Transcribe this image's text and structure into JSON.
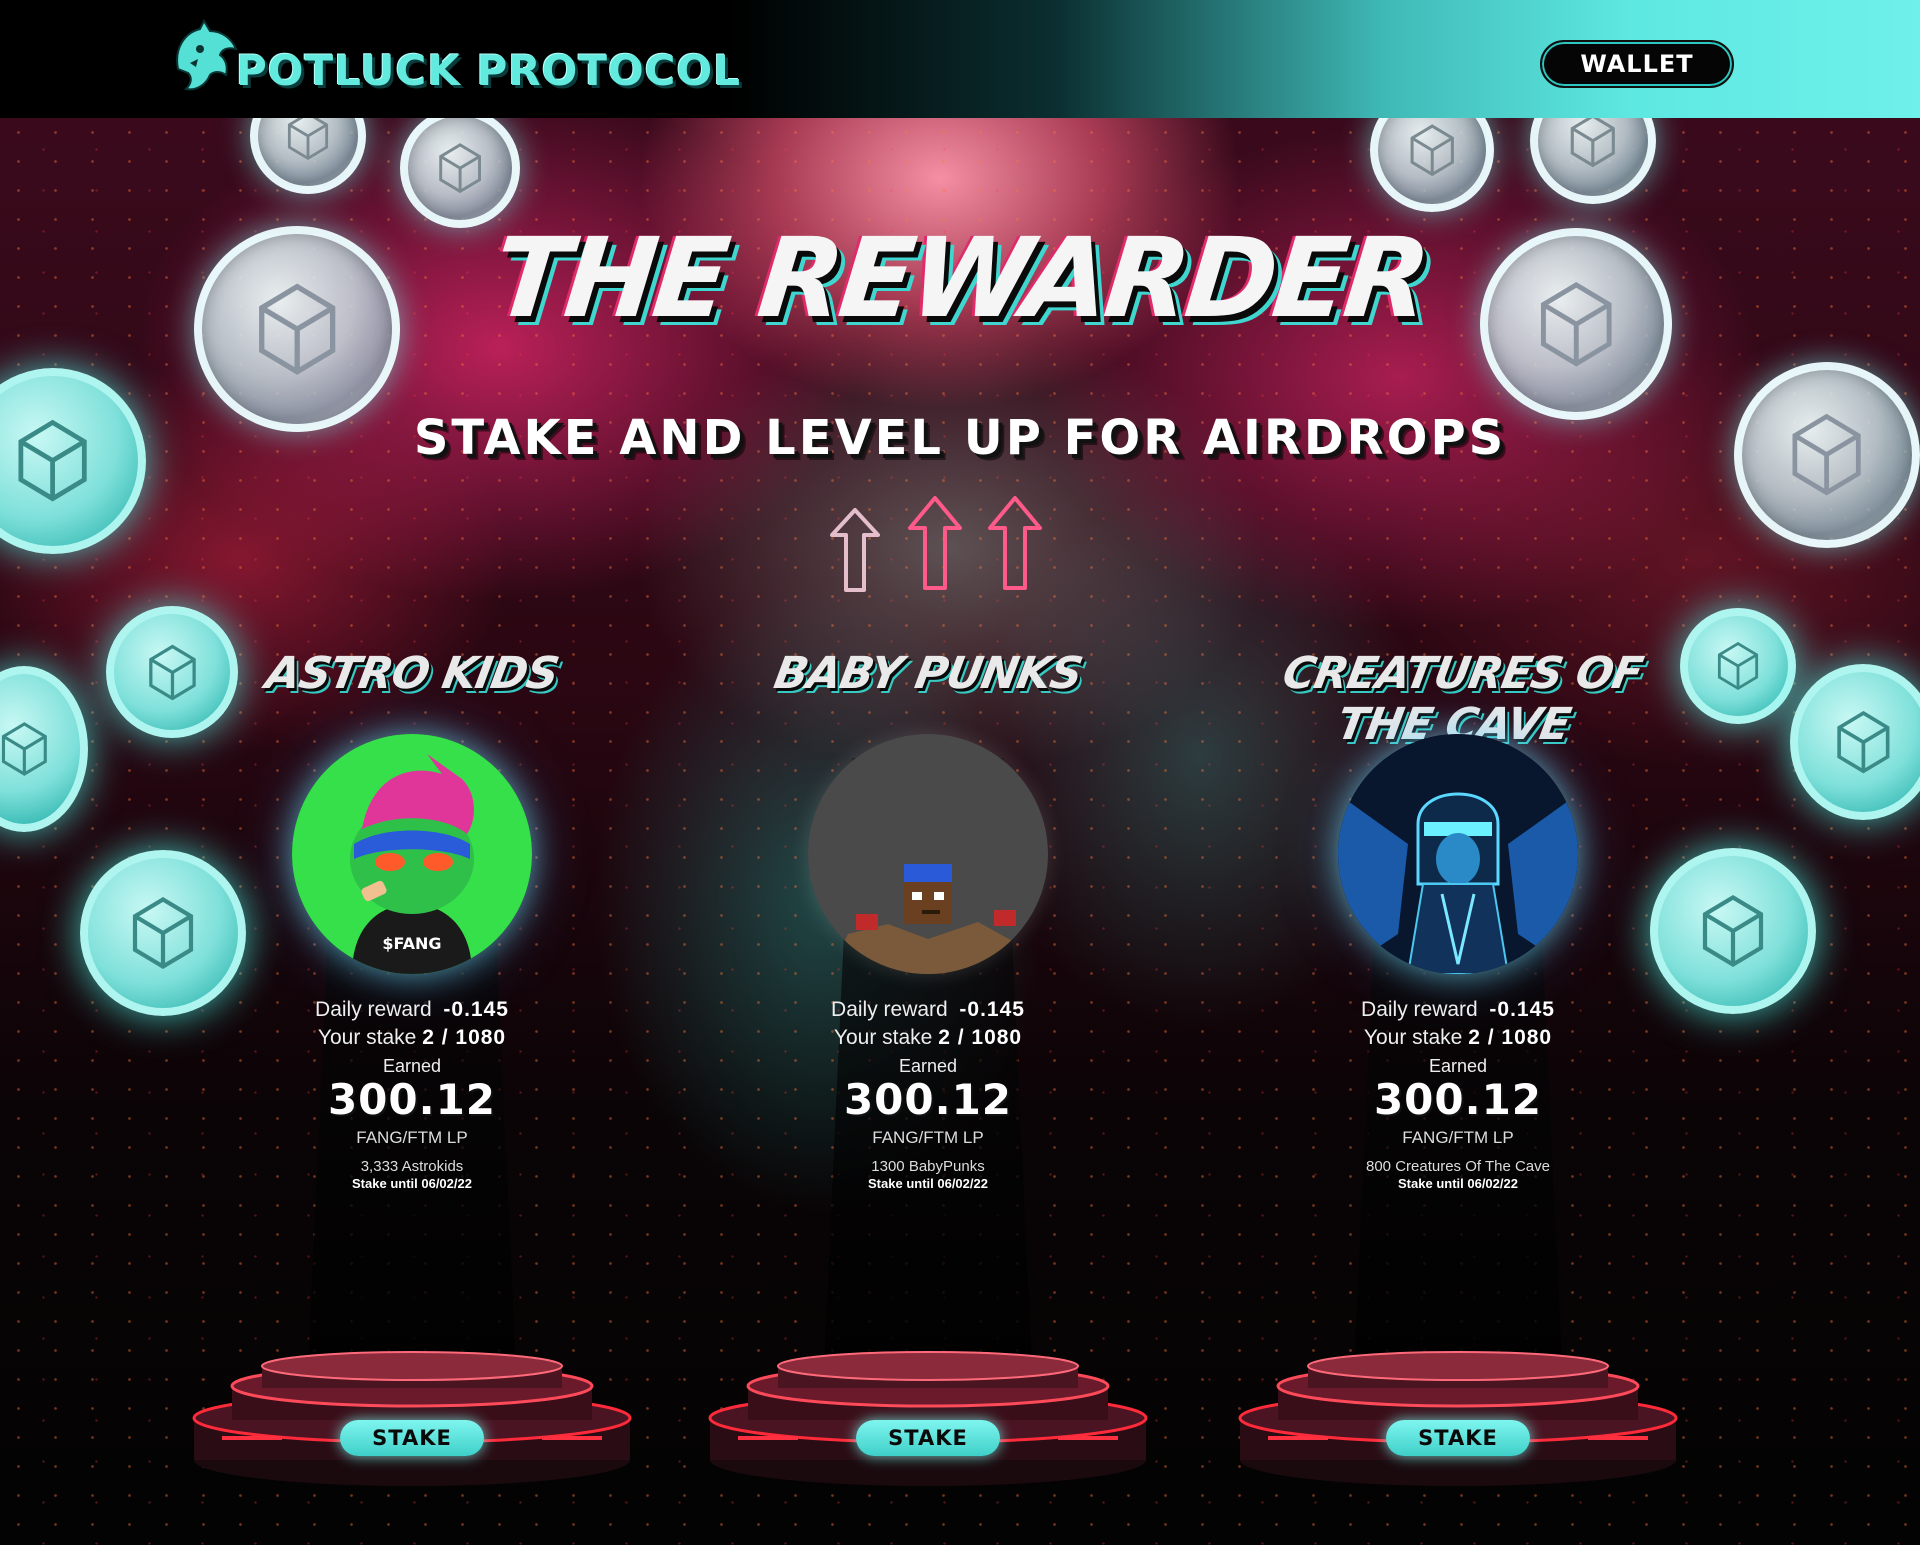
{
  "header": {
    "brand": "POTLUCK PROTOCOL",
    "wallet_label": "WALLET"
  },
  "hero": {
    "title": "THE REWARDER",
    "subtitle": "STAKE AND LEVEL UP FOR AIRDROPS"
  },
  "pools": [
    {
      "name": "ASTRO KIDS",
      "daily_reward_label": "Daily reward",
      "daily_reward_value": "-0.145",
      "stake_label": "Your stake",
      "stake_value": "2 / 1080",
      "earned_label": "Earned",
      "earned_value": "300.12",
      "lp_label": "FANG/FTM LP",
      "collection": "3,333 Astrokids",
      "stake_until": "Stake until  06/02/22",
      "button_label": "STAKE"
    },
    {
      "name": "BABY PUNKS",
      "daily_reward_label": "Daily reward",
      "daily_reward_value": "-0.145",
      "stake_label": "Your stake",
      "stake_value": "2 / 1080",
      "earned_label": "Earned",
      "earned_value": "300.12",
      "lp_label": "FANG/FTM LP",
      "collection": "1300 BabyPunks",
      "stake_until": "Stake until 06/02/22",
      "button_label": "STAKE"
    },
    {
      "name": "CREATURES OF THE CAVE",
      "daily_reward_label": "Daily reward",
      "daily_reward_value": "-0.145",
      "stake_label": "Your stake",
      "stake_value": "2 / 1080",
      "earned_label": "Earned",
      "earned_value": "300.12",
      "lp_label": "FANG/FTM LP",
      "collection": "800 Creatures Of The Cave",
      "stake_until": "Stake until 06/02/22",
      "button_label": "STAKE"
    }
  ],
  "colors": {
    "accent_teal": "#5ee8e2",
    "neon_red": "#ff2a3a",
    "background": "#050507"
  },
  "icons": [
    "bat-logo-icon",
    "fantom-coin-icon",
    "up-arrow-icon"
  ]
}
